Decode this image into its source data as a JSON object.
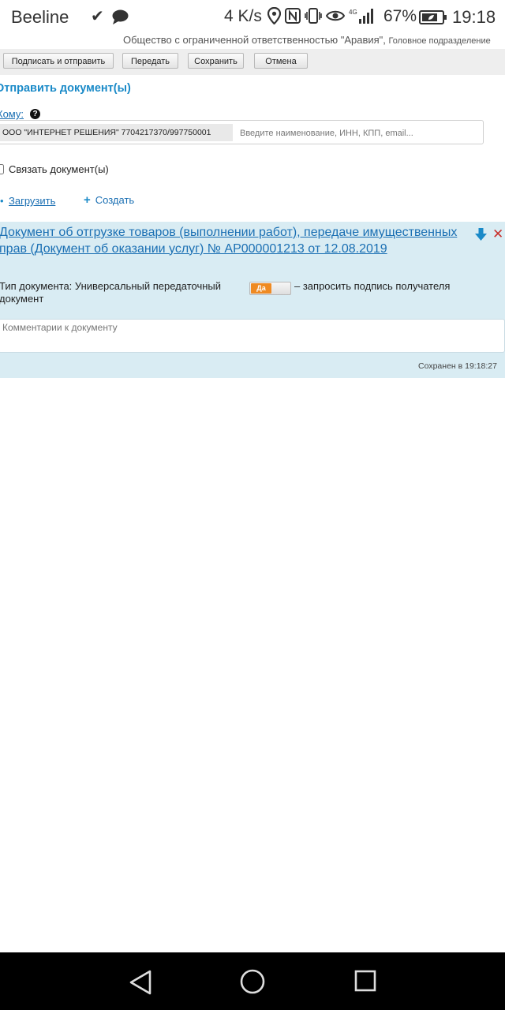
{
  "status_bar": {
    "carrier": "Beeline",
    "check_symbol": "✔",
    "speed": "4 K/s",
    "battery_percent": "67%",
    "time": "19:18",
    "network_label": "4G"
  },
  "org_line": {
    "main": "Общество с ограниченной ответственностью \"Аравия\",",
    "sub": "Головное подразделение"
  },
  "toolbar": {
    "sign_send": "Подписать и отправить",
    "transfer": "Передать",
    "save": "Сохранить",
    "cancel": "Отмена"
  },
  "form": {
    "title": "Отправить документ(ы)",
    "to_label": "Кому:",
    "help": "?",
    "recipient_chip": "ООО \"ИНТЕРНЕТ РЕШЕНИЯ\" 7704217370/997750001",
    "recipient_placeholder": "Введите наименование, ИНН, КПП, email...",
    "link_docs_label": "Связать документ(ы)",
    "upload_label": "Загрузить",
    "create_label": "Создать"
  },
  "document": {
    "title": "Документ об отгрузке товаров (выполнении работ), передаче имущественных прав (Документ об оказании услуг) № АР000001213 от 12.08.2019",
    "type_text": "Тип документа: Универсальный передаточный документ",
    "toggle_label": "Да",
    "signature_text": "– запросить подпись получателя",
    "comment_placeholder": "Комментарии к документу",
    "saved_status": "Сохранен в 19:18:27"
  },
  "colors": {
    "accent": "#1a8ac8",
    "link": "#1a6fb3",
    "panel_bg": "#d9ecf3",
    "toggle_on": "#ef8a22",
    "remove": "#c8322d"
  },
  "icons": [
    "check-icon",
    "chat-icon",
    "location-icon",
    "nfc-icon",
    "vibrate-icon",
    "eye-icon",
    "signal-icon",
    "battery-icon",
    "help-icon",
    "download-icon",
    "remove-icon",
    "back-icon",
    "home-icon",
    "recent-apps-icon"
  ]
}
